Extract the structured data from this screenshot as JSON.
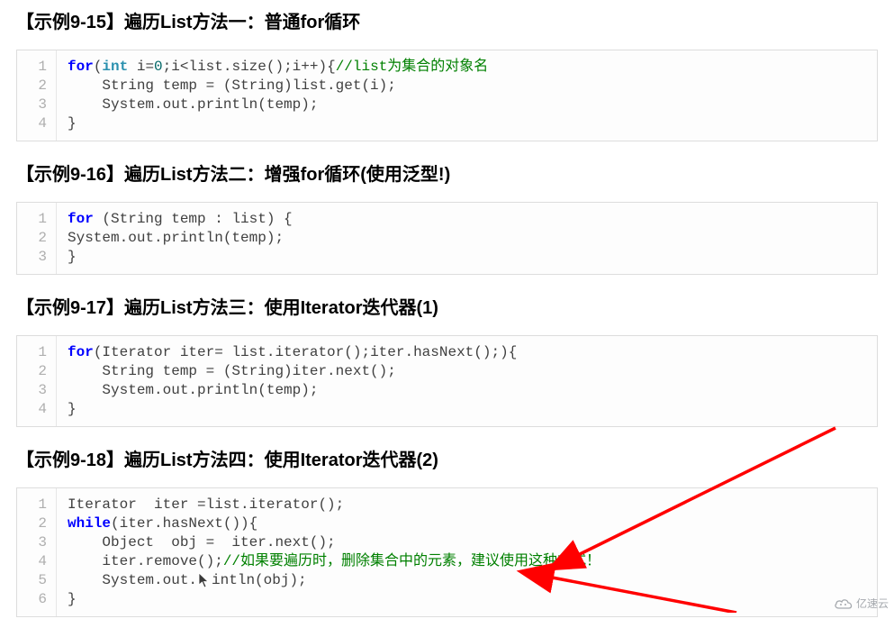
{
  "sections": [
    {
      "title": "【示例9-15】遍历List方法一：普通for循环",
      "lines": [
        "1",
        "2",
        "3",
        "4"
      ],
      "code": [
        {
          "segments": [
            {
              "t": "for",
              "cls": "kw-for"
            },
            {
              "t": "(",
              "cls": ""
            },
            {
              "t": "int",
              "cls": "kw-int"
            },
            {
              "t": " i=",
              "cls": ""
            },
            {
              "t": "0",
              "cls": "num"
            },
            {
              "t": ";i<list.size();i++){",
              "cls": ""
            },
            {
              "t": "//list为集合的对象名",
              "cls": "comment"
            }
          ]
        },
        {
          "segments": [
            {
              "t": "    String temp = (String)list.get(i);",
              "cls": ""
            }
          ]
        },
        {
          "segments": [
            {
              "t": "    System.out.println(temp);",
              "cls": ""
            }
          ]
        },
        {
          "segments": [
            {
              "t": "}",
              "cls": ""
            }
          ]
        }
      ]
    },
    {
      "title": "【示例9-16】遍历List方法二：增强for循环(使用泛型!)",
      "lines": [
        "1",
        "2",
        "3"
      ],
      "code": [
        {
          "segments": [
            {
              "t": "for",
              "cls": "kw-for"
            },
            {
              "t": " (String temp : list) {",
              "cls": ""
            }
          ]
        },
        {
          "segments": [
            {
              "t": "System.out.println(temp);",
              "cls": ""
            }
          ]
        },
        {
          "segments": [
            {
              "t": "}",
              "cls": ""
            }
          ]
        }
      ]
    },
    {
      "title": "【示例9-17】遍历List方法三：使用Iterator迭代器(1)",
      "lines": [
        "1",
        "2",
        "3",
        "4"
      ],
      "code": [
        {
          "segments": [
            {
              "t": "for",
              "cls": "kw-for"
            },
            {
              "t": "(Iterator iter= list.iterator();iter.hasNext();){",
              "cls": ""
            }
          ]
        },
        {
          "segments": [
            {
              "t": "    String temp = (String)iter.next();",
              "cls": ""
            }
          ]
        },
        {
          "segments": [
            {
              "t": "    System.out.println(temp);",
              "cls": ""
            }
          ]
        },
        {
          "segments": [
            {
              "t": "}",
              "cls": ""
            }
          ]
        }
      ]
    },
    {
      "title": "【示例9-18】遍历List方法四：使用Iterator迭代器(2)",
      "lines": [
        "1",
        "2",
        "3",
        "4",
        "5",
        "6"
      ],
      "code": [
        {
          "segments": [
            {
              "t": "Iterator  iter =list.iterator();",
              "cls": ""
            }
          ]
        },
        {
          "segments": [
            {
              "t": "while",
              "cls": "kw-while"
            },
            {
              "t": "(iter.hasNext()){",
              "cls": ""
            }
          ]
        },
        {
          "segments": [
            {
              "t": "    Object  obj =  iter.next();",
              "cls": ""
            }
          ]
        },
        {
          "segments": [
            {
              "t": "    iter.remove();",
              "cls": ""
            },
            {
              "t": "//如果要遍历时，删除集合中的元素，建议使用这种方式！",
              "cls": "comment"
            }
          ]
        },
        {
          "segments": [
            {
              "t": "    System.out.",
              "cls": ""
            },
            {
              "t": "[CURSOR]",
              "cls": "cursor"
            },
            {
              "t": "intln(obj);",
              "cls": ""
            }
          ]
        },
        {
          "segments": [
            {
              "t": "}",
              "cls": ""
            }
          ]
        }
      ]
    }
  ],
  "watermark": {
    "text": "亿速云"
  },
  "colors": {
    "arrow": "#ff0000",
    "keyword_blue": "#0000ff",
    "type_teal": "#2b91af",
    "number": "#006666",
    "comment_green": "#008000"
  }
}
